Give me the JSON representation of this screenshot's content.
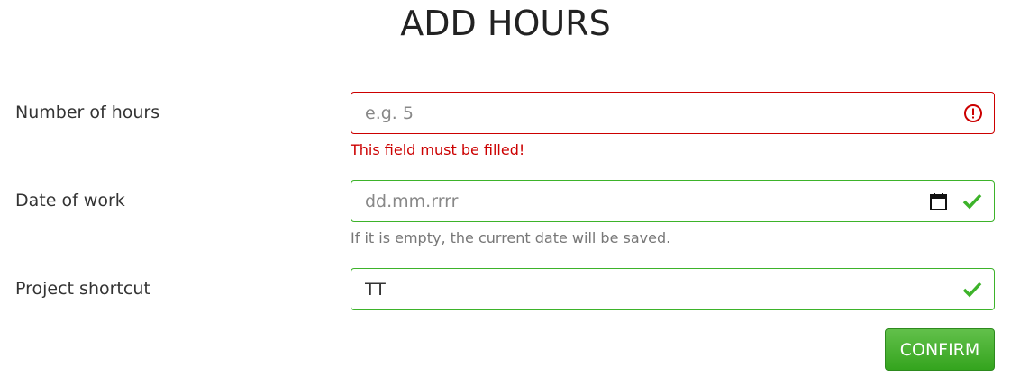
{
  "title": "ADD HOURS",
  "colors": {
    "error": "#cc0000",
    "success": "#3db32a"
  },
  "fields": [
    {
      "label": "Number of hours",
      "placeholder": "e.g. 5",
      "value": "",
      "state": "error",
      "icon": "exclamation-circle-icon",
      "message": "This field must be filled!"
    },
    {
      "label": "Date of work",
      "placeholder": "dd.mm.rrrr",
      "value": "",
      "state": "valid",
      "icon": "check-icon",
      "message": "If it is empty, the current date will be saved."
    },
    {
      "label": "Project shortcut",
      "placeholder": "",
      "value": "TT",
      "state": "valid",
      "icon": "check-icon"
    }
  ],
  "confirm_label": "CONFIRM"
}
